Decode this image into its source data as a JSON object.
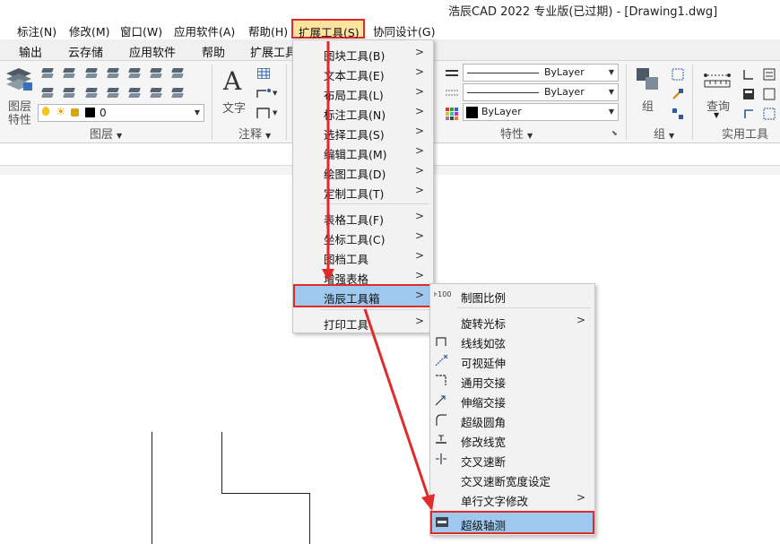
{
  "window": {
    "title": "浩辰CAD 2022 专业版(已过期) - [Drawing1.dwg]"
  },
  "menubar": {
    "items": [
      {
        "label": "标注(N)"
      },
      {
        "label": "修改(M)"
      },
      {
        "label": "窗口(W)"
      },
      {
        "label": "应用软件(A)"
      },
      {
        "label": "帮助(H)"
      },
      {
        "label": "扩展工具(S)"
      },
      {
        "label": "协同设计(G)"
      }
    ]
  },
  "ribbon_tabs": [
    "输出",
    "云存储",
    "应用软件",
    "帮助",
    "扩展工具"
  ],
  "ribbon": {
    "layer_panel": {
      "big_label_1": "图层",
      "big_label_2": "特性",
      "layer_value": "0",
      "group_label": "图层"
    },
    "annotation_panel": {
      "text_label": "文字",
      "group_label": "注释"
    },
    "properties_panel": {
      "linetype": "ByLayer",
      "lineweight": "ByLayer",
      "color": "ByLayer",
      "group_label": "特性"
    },
    "group_panel": {
      "button_label": "组",
      "group_label": "组"
    },
    "utility_panel": {
      "query_label": "查询",
      "group_label": "实用工具"
    }
  },
  "extend_menu": {
    "items": [
      {
        "label": "图块工具(B)",
        "submenu": true
      },
      {
        "label": "文本工具(E)",
        "submenu": true
      },
      {
        "label": "布局工具(L)",
        "submenu": true
      },
      {
        "label": "标注工具(N)",
        "submenu": true
      },
      {
        "label": "选择工具(S)",
        "submenu": true
      },
      {
        "label": "编辑工具(M)",
        "submenu": true
      },
      {
        "label": "绘图工具(D)",
        "submenu": true
      },
      {
        "label": "定制工具(T)",
        "submenu": true
      },
      {
        "label": "表格工具(F)",
        "submenu": true
      },
      {
        "label": "坐标工具(C)",
        "submenu": true
      },
      {
        "label": "图档工具",
        "submenu": true
      },
      {
        "label": "增强表格",
        "submenu": true
      },
      {
        "label": "浩辰工具箱",
        "submenu": true,
        "highlighted": true
      },
      {
        "label": "打印工具",
        "submenu": true
      }
    ]
  },
  "toolbox_submenu": {
    "items": [
      {
        "label": "制图比例",
        "icon": "scale-icon"
      },
      {
        "label": "旋转光标",
        "icon": "",
        "submenu": true
      },
      {
        "label": "线线如弦",
        "icon": "line-chord-icon"
      },
      {
        "label": "可视延伸",
        "icon": "extend-icon"
      },
      {
        "label": "通用交接",
        "icon": "junction-icon"
      },
      {
        "label": "伸缩交接",
        "icon": "stretch-junction-icon"
      },
      {
        "label": "超级圆角",
        "icon": "fillet-icon"
      },
      {
        "label": "修改线宽",
        "icon": "lineweight-icon"
      },
      {
        "label": "交叉速断",
        "icon": "cross-break-icon"
      },
      {
        "label": "交叉速断宽度设定",
        "icon": ""
      },
      {
        "label": "单行文字修改",
        "icon": "",
        "submenu": true
      },
      {
        "label": "超级轴测",
        "icon": "axonometric-icon",
        "highlighted": true
      }
    ]
  },
  "colors": {
    "highlight_border": "#e12a2a",
    "menu_highlight": "#9ec8ee",
    "active_menu": "#fde3a0"
  }
}
